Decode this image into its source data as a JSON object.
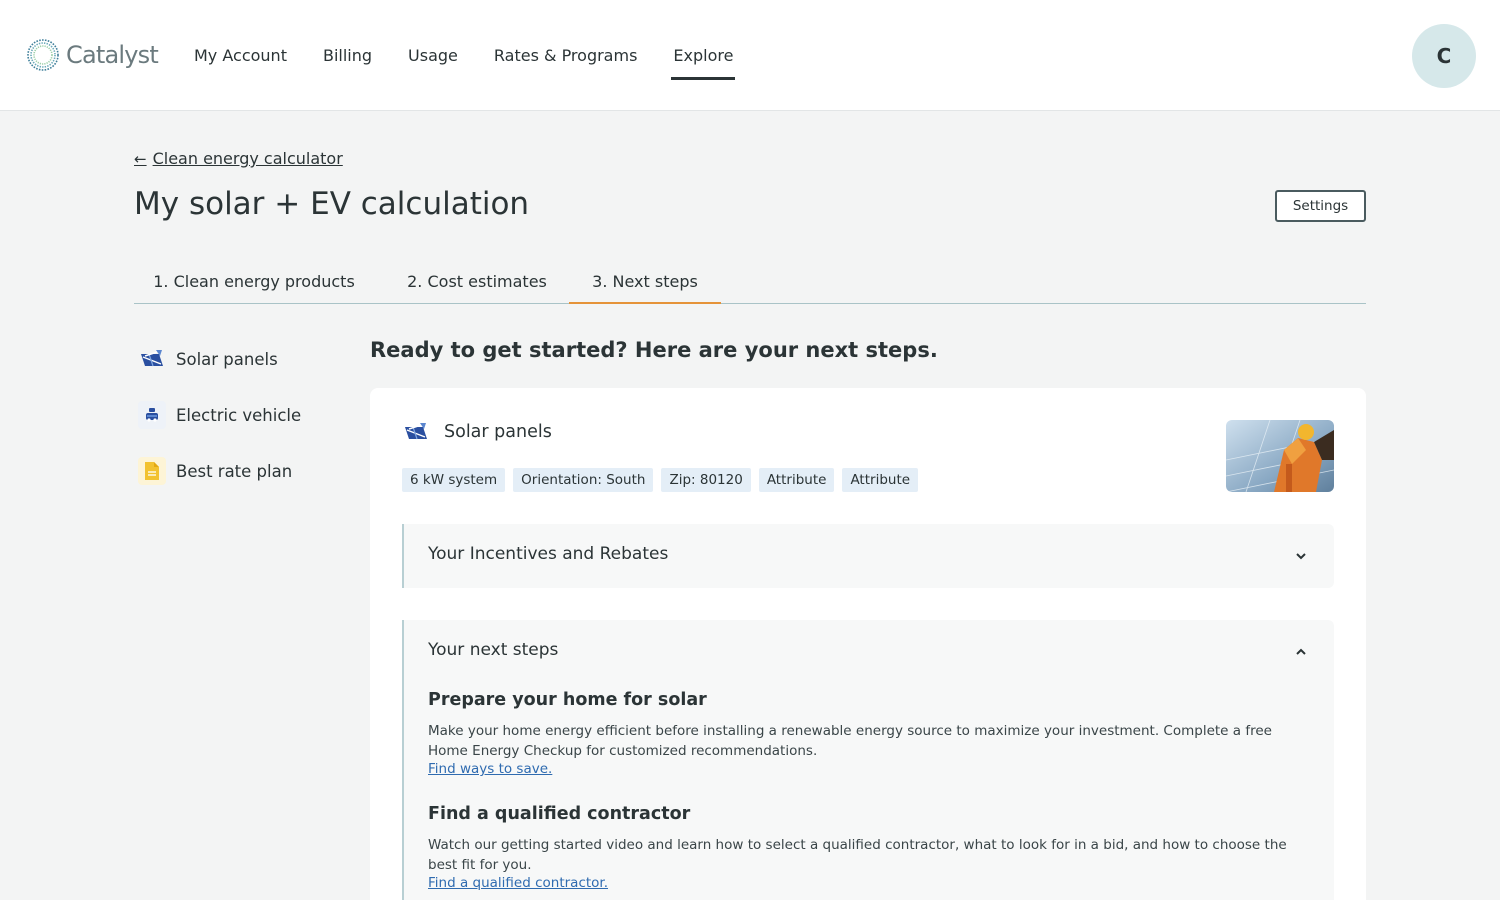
{
  "brand": {
    "name": "Catalyst"
  },
  "nav": {
    "items": [
      {
        "label": "My Account"
      },
      {
        "label": "Billing"
      },
      {
        "label": "Usage"
      },
      {
        "label": "Rates & Programs"
      },
      {
        "label": "Explore",
        "active": true
      }
    ]
  },
  "user": {
    "initial": "C"
  },
  "page": {
    "back_link": "Clean energy calculator",
    "title": "My solar + EV calculation",
    "settings_label": "Settings"
  },
  "tabs": [
    {
      "label": "1. Clean energy products"
    },
    {
      "label": "2. Cost estimates"
    },
    {
      "label": "3. Next steps",
      "active": true
    }
  ],
  "sidebar": {
    "items": [
      {
        "label": "Solar panels",
        "icon": "solar-panel-icon"
      },
      {
        "label": "Electric vehicle",
        "icon": "car-icon"
      },
      {
        "label": "Best rate plan",
        "icon": "document-icon"
      }
    ]
  },
  "main": {
    "heading": "Ready to get started? Here are your next steps.",
    "card": {
      "title": "Solar panels",
      "tags": [
        "6 kW system",
        "Orientation: South",
        "Zip: 80120",
        "Attribute",
        "Attribute"
      ],
      "incentives": {
        "title": "Your Incentives and Rebates",
        "expanded": false
      },
      "next_steps": {
        "title": "Your next steps",
        "expanded": true,
        "steps": [
          {
            "title": "Prepare your home for solar",
            "body": "Make your home energy efficient before installing a renewable energy source to maximize your investment. Complete a free Home Energy Checkup for customized recommendations.",
            "link": "Find ways to save."
          },
          {
            "title": "Find a qualified contractor",
            "body": "Watch our getting started video and learn how to select a qualified contractor, what to look for in a bid, and how to choose the best fit for you.",
            "link": "Find a qualified contractor."
          }
        ]
      }
    }
  },
  "colors": {
    "accent": "#e59339",
    "link": "#2f6bb0",
    "tag_bg": "#e4eef7",
    "avatar_bg": "#d6e8ea",
    "solar_icon": "#2a4fa0",
    "car_icon": "#2a4fa0",
    "doc_icon": "#f2c230"
  }
}
